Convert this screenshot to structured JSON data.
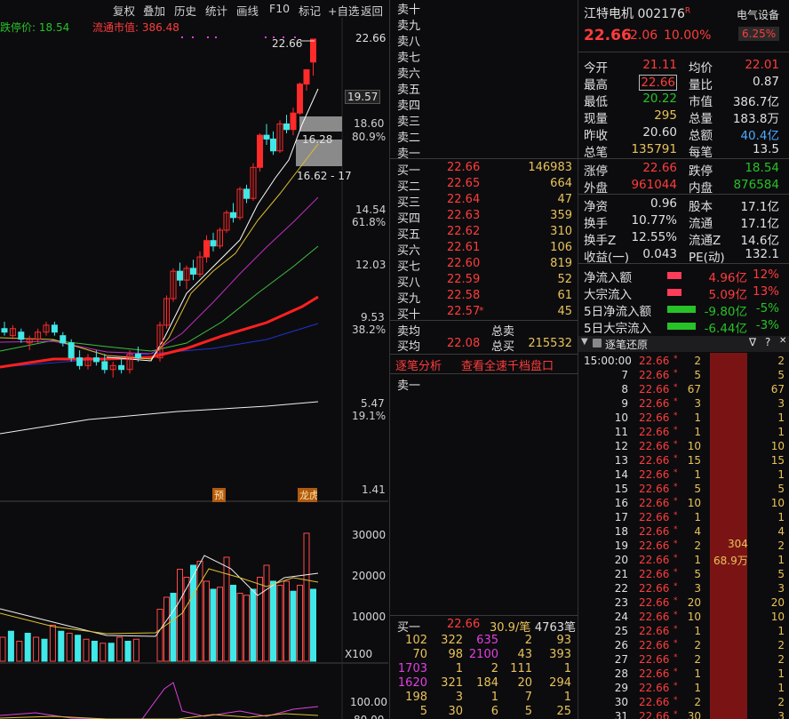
{
  "toolbar": {
    "items": [
      "复权",
      "叠加",
      "历史",
      "统计",
      "画线",
      "F10",
      "标记",
      "+自选",
      "返回"
    ]
  },
  "chart": {
    "limit_down_label": "跌停价: 18.54",
    "mktcap_label": "流通市值: 386.48",
    "price_axis": [
      "22.66",
      "19.57",
      "18.60",
      "80.9%",
      "16.28",
      "16.62 - 17",
      "14.54",
      "61.8%",
      "12.03",
      "9.53",
      "38.2%",
      "5.47",
      "19.1%",
      "1.41"
    ],
    "high_tag": "22.66",
    "vol_axis": [
      "30000",
      "20000",
      "10000",
      "X100"
    ],
    "ind_axis": [
      "100.00",
      "80.00"
    ],
    "badges": [
      "预",
      "龙虎榜"
    ]
  },
  "chart_data": {
    "type": "candlestick",
    "candles": [
      [
        9.2,
        9.4,
        9.0,
        9.1
      ],
      [
        9.0,
        9.3,
        8.9,
        9.2
      ],
      [
        9.1,
        9.2,
        8.8,
        8.9
      ],
      [
        8.8,
        9.0,
        8.6,
        8.9
      ],
      [
        8.9,
        9.2,
        8.8,
        9.1
      ],
      [
        9.1,
        9.4,
        9.0,
        9.3
      ],
      [
        9.3,
        9.4,
        9.0,
        9.1
      ],
      [
        9.0,
        9.1,
        8.7,
        8.8
      ],
      [
        8.8,
        8.9,
        8.3,
        8.4
      ],
      [
        8.4,
        8.6,
        8.1,
        8.2
      ],
      [
        8.2,
        8.5,
        8.1,
        8.4
      ],
      [
        8.4,
        8.6,
        8.2,
        8.3
      ],
      [
        8.3,
        8.5,
        8.0,
        8.1
      ],
      [
        8.1,
        8.3,
        7.9,
        8.2
      ],
      [
        8.2,
        8.4,
        8.0,
        8.1
      ],
      [
        8.1,
        8.6,
        8.0,
        8.5
      ],
      [
        8.5,
        8.7,
        8.3,
        8.4
      ],
      [
        8.4,
        9.4,
        8.3,
        9.3
      ],
      [
        9.3,
        10.2,
        9.2,
        10.1
      ],
      [
        10.1,
        11.1,
        10.0,
        11.0
      ],
      [
        11.0,
        11.3,
        10.5,
        10.7
      ],
      [
        10.7,
        11.2,
        10.4,
        11.1
      ],
      [
        11.1,
        11.4,
        10.7,
        10.9
      ],
      [
        10.9,
        11.7,
        10.8,
        11.5
      ],
      [
        11.5,
        12.3,
        11.3,
        12.1
      ],
      [
        12.1,
        12.4,
        11.7,
        11.9
      ],
      [
        11.9,
        12.6,
        11.8,
        12.5
      ],
      [
        12.5,
        13.3,
        12.4,
        13.2
      ],
      [
        13.2,
        13.6,
        12.8,
        13.0
      ],
      [
        13.0,
        14.3,
        12.9,
        14.2
      ],
      [
        14.2,
        14.4,
        13.6,
        13.8
      ],
      [
        13.8,
        15.4,
        13.7,
        15.2
      ],
      [
        15.2,
        16.9,
        15.0,
        16.8
      ],
      [
        16.8,
        17.4,
        16.3,
        16.6
      ],
      [
        16.6,
        17.0,
        15.8,
        16.0
      ],
      [
        16.0,
        17.6,
        15.9,
        17.4
      ],
      [
        17.4,
        17.9,
        16.9,
        17.1
      ],
      [
        17.1,
        18.3,
        16.8,
        18.0
      ],
      [
        18.0,
        19.8,
        17.9,
        19.7
      ],
      [
        19.7,
        20.6,
        19.3,
        20.6
      ],
      [
        21.1,
        22.66,
        20.22,
        22.66
      ]
    ],
    "volumes": [
      6000,
      7500,
      5000,
      7000,
      6000,
      5500,
      9000,
      7500,
      7000,
      6500,
      5500,
      5000,
      4500,
      4500,
      6000,
      5000,
      5500,
      13000,
      16000,
      17000,
      23000,
      21000,
      24000,
      25000,
      20000,
      18000,
      18500,
      26000,
      19000,
      17000,
      16500,
      18000,
      21000,
      24000,
      20000,
      19000,
      20000,
      17500,
      19000,
      32000,
      18000
    ],
    "legend": "none"
  },
  "orderbook": {
    "sell_labels": [
      "卖十",
      "卖九",
      "卖八",
      "卖七",
      "卖六",
      "卖五",
      "卖四",
      "卖三",
      "卖二",
      "卖一"
    ],
    "buy": [
      [
        "买一",
        "22.66",
        "146983"
      ],
      [
        "买二",
        "22.65",
        "664"
      ],
      [
        "买三",
        "22.64",
        "47"
      ],
      [
        "买四",
        "22.63",
        "359"
      ],
      [
        "买五",
        "22.62",
        "310"
      ],
      [
        "买六",
        "22.61",
        "106"
      ],
      [
        "买七",
        "22.60",
        "819"
      ],
      [
        "买八",
        "22.59",
        "52"
      ],
      [
        "买九",
        "22.58",
        "61"
      ],
      [
        "买十",
        "22.57",
        "45"
      ]
    ],
    "buy_star": "*",
    "avg_sell_label": "卖均",
    "total_sell_label": "总卖",
    "avg_buy_label": "买均",
    "avg_buy": "22.08",
    "total_buy_label": "总买",
    "total_buy": "215532",
    "tab1": "逐笔分析",
    "tab2": "查看全速千档盘口",
    "sell1": "卖一",
    "b1_label": "买一",
    "b1_price": "22.66",
    "b1_per": "30.9/笔",
    "b1_vol": "4763笔",
    "grid": [
      [
        "102",
        "322",
        "635",
        "2",
        "93"
      ],
      [
        "70",
        "98",
        "2100",
        "43",
        "393"
      ],
      [
        "1703",
        "1",
        "2",
        "111",
        "1"
      ],
      [
        "1620",
        "321",
        "184",
        "20",
        "294"
      ],
      [
        "198",
        "3",
        "1",
        "7",
        "1"
      ],
      [
        "5",
        "30",
        "6",
        "5",
        "25"
      ]
    ]
  },
  "stock": {
    "name": "江特电机",
    "code": "002176",
    "badge": "R",
    "sector": "电气设备",
    "sector_pct": "6.25%",
    "price": "22.66",
    "change": "2.06",
    "pct": "10.00%",
    "kv": [
      [
        "今开",
        "21.11",
        "均价",
        "22.01"
      ],
      [
        "最高",
        "22.66",
        "量比",
        "0.87"
      ],
      [
        "最低",
        "20.22",
        "市值",
        "386.7亿"
      ],
      [
        "现量",
        "295",
        "总量",
        "183.8万"
      ],
      [
        "昨收",
        "20.60",
        "总额",
        "40.4亿"
      ],
      [
        "总笔",
        "135791",
        "每笔",
        "13.5"
      ],
      [
        "涨停",
        "22.66",
        "跌停",
        "18.54"
      ],
      [
        "外盘",
        "961044",
        "内盘",
        "876584"
      ],
      [
        "净资",
        "0.96",
        "股本",
        "17.1亿"
      ],
      [
        "换手",
        "10.77%",
        "流通",
        "17.1亿"
      ],
      [
        "换手Z",
        "12.55%",
        "流通Z",
        "14.6亿"
      ],
      [
        "收益(一)",
        "0.043",
        "PE(动)",
        "132.1"
      ]
    ],
    "flows": [
      [
        "净流入额",
        "4.96亿",
        "12%"
      ],
      [
        "大宗流入",
        "5.09亿",
        "13%"
      ],
      [
        "5日净流入额",
        "-9.80亿",
        "-5%"
      ],
      [
        "5日大宗流入",
        "-6.44亿",
        "-3%"
      ]
    ],
    "tick_title": "逐笔还原",
    "ticks": [
      [
        "15:00:00",
        "22.66",
        "2",
        "2"
      ],
      [
        "7",
        "22.66",
        "5",
        "5"
      ],
      [
        "8",
        "22.66",
        "67",
        "67"
      ],
      [
        "9",
        "22.66",
        "3",
        "3"
      ],
      [
        "10",
        "22.66",
        "1",
        "1"
      ],
      [
        "11",
        "22.66",
        "1",
        "1"
      ],
      [
        "12",
        "22.66",
        "10",
        "10"
      ],
      [
        "13",
        "22.66",
        "15",
        "15"
      ],
      [
        "14",
        "22.66",
        "1",
        "1"
      ],
      [
        "15",
        "22.66",
        "5",
        "5"
      ],
      [
        "16",
        "22.66",
        "10",
        "10"
      ],
      [
        "17",
        "22.66",
        "1",
        "1"
      ],
      [
        "18",
        "22.66",
        "4",
        "4"
      ],
      [
        "19",
        "22.66",
        "2",
        "2"
      ],
      [
        "20",
        "22.66",
        "1",
        "1"
      ],
      [
        "21",
        "22.66",
        "5",
        "5"
      ],
      [
        "22",
        "22.66",
        "3",
        "3"
      ],
      [
        "23",
        "22.66",
        "20",
        "20"
      ],
      [
        "24",
        "22.66",
        "10",
        "10"
      ],
      [
        "25",
        "22.66",
        "1",
        "1"
      ],
      [
        "26",
        "22.66",
        "2",
        "2"
      ],
      [
        "27",
        "22.66",
        "2",
        "2"
      ],
      [
        "28",
        "22.66",
        "1",
        "1"
      ],
      [
        "29",
        "22.66",
        "1",
        "1"
      ],
      [
        "30",
        "22.66",
        "2",
        "2"
      ],
      [
        "31",
        "22.66",
        "30",
        "3"
      ]
    ],
    "tick_mark": "*",
    "big_order": [
      "304",
      "68.9万"
    ]
  }
}
